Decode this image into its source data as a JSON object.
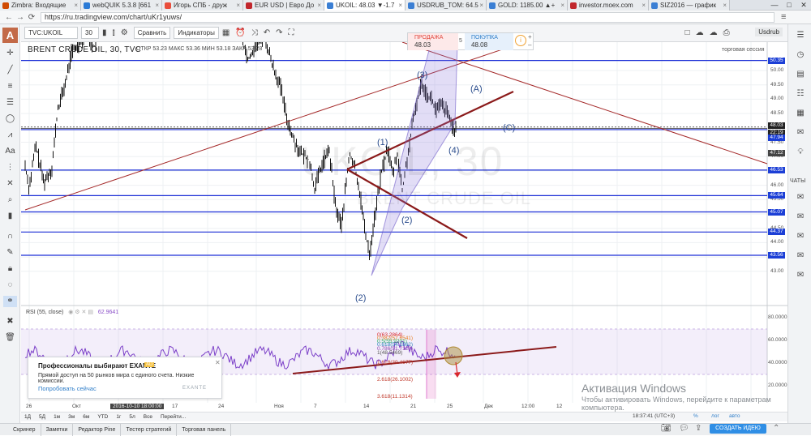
{
  "browser": {
    "tabs": [
      {
        "title": "Zimbra: Входящие",
        "color": "#d04a02"
      },
      {
        "title": "webQUIK 5.3.8 [661",
        "color": "#2b7bd6"
      },
      {
        "title": "Игорь СПБ - друж",
        "color": "#e94e3c"
      },
      {
        "title": "EUR USD | Евро До",
        "color": "#c1272d"
      },
      {
        "title": "UKOIL: 48.03 ▼-1.7",
        "color": "#3b7fd4",
        "active": true
      },
      {
        "title": "USDRUB_TOM: 64.5",
        "color": "#3b7fd4"
      },
      {
        "title": "GOLD: 1185.00 ▲+",
        "color": "#3b7fd4"
      },
      {
        "title": "investor.moex.com",
        "color": "#c1272d"
      },
      {
        "title": "SIZ2016 — график",
        "color": "#3b7fd4"
      }
    ],
    "url": "https://ru.tradingview.com/chart/uKr1yuws/",
    "window_controls": [
      "—",
      "□",
      "✕"
    ]
  },
  "toolbar": {
    "symbol": "TVC:UKOIL",
    "interval": "30",
    "compare": "Сравнить",
    "indicators": "Индикаторы",
    "user": "Usdrub"
  },
  "trade_widget": {
    "sell_label": "ПРОДАЖА",
    "sell_price": "48.03",
    "spread": "5",
    "buy_label": "ПОКУПКА",
    "buy_price": "48.08"
  },
  "legend": {
    "title": "BRENT CRUDE OIL, 30, TVC",
    "ohlc": "ОТКР 53.23  МАКС 53.36  МИН 53.18  ЗАКР 53.28",
    "session": "торговая сессия"
  },
  "price_scale": {
    "labels": [
      "50.00",
      "49.50",
      "49.00",
      "48.50",
      "48.00",
      "47.50",
      "47.00",
      "46.50",
      "46.00",
      "45.50",
      "45.00",
      "44.50",
      "44.00",
      "43.50",
      "43.00"
    ],
    "badges": [
      {
        "text": "50.35",
        "color": "#1c3fd6"
      },
      {
        "text": "48.03",
        "color": "#222222"
      },
      {
        "text": "22:19",
        "color": "#222222"
      },
      {
        "text": "47.94",
        "color": "#1c3fd6"
      },
      {
        "text": "47.12",
        "color": "#444444"
      },
      {
        "text": "46.53",
        "color": "#1c3fd6"
      },
      {
        "text": "45.64",
        "color": "#1c3fd6"
      },
      {
        "text": "45.07",
        "color": "#1c3fd6"
      },
      {
        "text": "44.37",
        "color": "#1c3fd6"
      },
      {
        "text": "43.56",
        "color": "#1c3fd6"
      }
    ]
  },
  "watermark": {
    "symbol": "UKOIL, 30",
    "name": "BRENT CRUDE OIL"
  },
  "wave_labels": {
    "w3": "(3)",
    "wA": "(A)",
    "wC": "(C)",
    "w1": "(1)",
    "w4": "(4)",
    "w2a": "(2)",
    "w2b": "(2)"
  },
  "rsi": {
    "legend": "RSI (55, close)",
    "value": "62.9641",
    "scale": [
      "80.0000",
      "60.0000",
      "40.0000",
      "20.0000"
    ],
    "fib": [
      "0(63.2864)",
      "0.382(57.6541)",
      "0.5(55.9201)",
      "0.618(54.1862)",
      "0.786(51.7128)",
      "1(48.5469)",
      "1.618(39.4677)",
      "2.618(26.1002)",
      "3.618(11.1314)"
    ]
  },
  "time_axis": {
    "labels": [
      "26",
      "Окт",
      "10",
      "17",
      "24",
      "Ноя",
      "7",
      "14",
      "21",
      "25",
      "Дек",
      "12:00",
      "12"
    ],
    "cursor_time": "2016-10-10 18:00:00"
  },
  "range_bar": {
    "ranges": [
      "1Д",
      "5Д",
      "1м",
      "3м",
      "6м",
      "YTD",
      "1г",
      "5л",
      "Все",
      "Перейти..."
    ],
    "utc": "18:37:41 (UTC+3)",
    "mode_labels": [
      "%",
      "лог",
      "авто"
    ]
  },
  "bottom_tabs": [
    "Скринер",
    "Заметки",
    "Редактор Pine",
    "Тестер стратегий",
    "Торговая панель"
  ],
  "publish_label": "СОЗДАТЬ ИДЕЮ",
  "exante": {
    "title": "Профессионалы выбирают EXANTE",
    "ad": "AD",
    "text": "Прямой доступ на 50 рынков мира с единого счета. Низкие комиссии.",
    "link": "Попробовать сейчас",
    "brand": "EXANTE"
  },
  "windows_activation": {
    "title": "Активация Windows",
    "text": "Чтобы активировать Windows, перейдите к параметрам компьютера."
  },
  "right_panel": {
    "chats": "ЧАТЫ"
  }
}
